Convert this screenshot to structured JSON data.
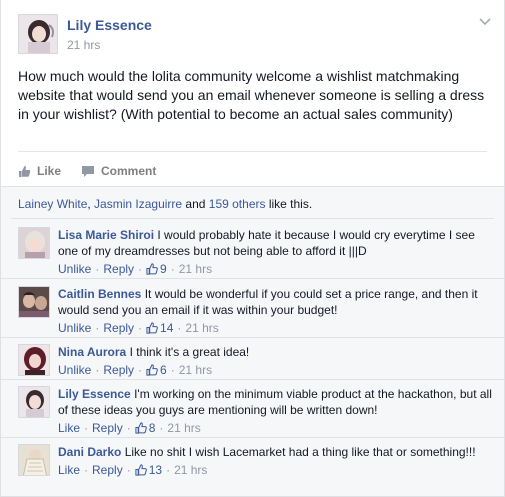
{
  "post": {
    "author": "Lily Essence",
    "time": "21 hrs",
    "text": "How much would the lolita community welcome a wishlist matchmaking website that would send you an email whenever someone is selling a dress in your wishlist? (With potential to become an actual sales community)",
    "like_label": "Like",
    "comment_label": "Comment"
  },
  "likes": {
    "name1": "Lainey White",
    "sep1": ", ",
    "name2": "Jasmin Izaguirre",
    "and": " and ",
    "others": "159 others",
    "suffix": " like this."
  },
  "comments": [
    {
      "name": "Lisa Marie Shiroi",
      "text": "I would probably hate it because I would cry everytime I see one of my dreamdresses but not being able to afford it |||D",
      "action": "Unlike",
      "reply": "Reply",
      "likes": "9",
      "time": "21 hrs"
    },
    {
      "name": "Caitlin Bennes",
      "text": "It would be wonderful if you could set a price range, and then it would send you an email if it was within your budget!",
      "action": "Unlike",
      "reply": "Reply",
      "likes": "14",
      "time": "21 hrs"
    },
    {
      "name": "Nina Aurora",
      "text": "I think it's a great idea!",
      "action": "Unlike",
      "reply": "Reply",
      "likes": "6",
      "time": "21 hrs"
    },
    {
      "name": "Lily Essence",
      "text": "I'm working on the minimum viable product at the hackathon, but all of these ideas you guys are mentioning will be written down!",
      "action": "Like",
      "reply": "Reply",
      "likes": "8",
      "time": "21 hrs"
    },
    {
      "name": "Dani Darko",
      "text": "Like no shit I wish Lacemarket had a thing like that or something!!!",
      "action": "Like",
      "reply": "Reply",
      "likes": "13",
      "time": "21 hrs"
    }
  ],
  "colors": {
    "link": "#3b5998",
    "meta": "#9197a3",
    "feedback_bg": "#f6f7f9"
  }
}
